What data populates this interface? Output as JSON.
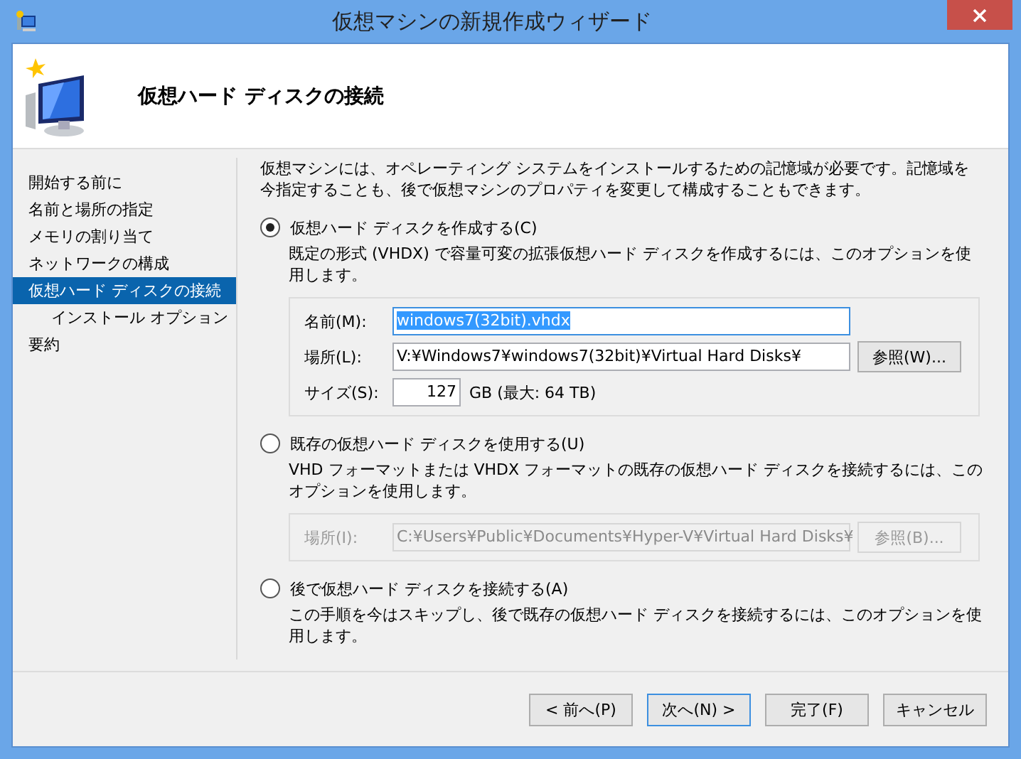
{
  "window": {
    "title": "仮想マシンの新規作成ウィザード"
  },
  "header": {
    "title": "仮想ハード ディスクの接続"
  },
  "sidebar": {
    "items": [
      {
        "label": "開始する前に",
        "selected": false
      },
      {
        "label": "名前と場所の指定",
        "selected": false
      },
      {
        "label": "メモリの割り当て",
        "selected": false
      },
      {
        "label": "ネットワークの構成",
        "selected": false
      },
      {
        "label": "仮想ハード ディスクの接続",
        "selected": true,
        "children": [
          {
            "label": "インストール オプション",
            "selected": false
          }
        ]
      },
      {
        "label": "要約",
        "selected": false
      }
    ]
  },
  "intro": "仮想マシンには、オペレーティング システムをインストールするための記憶域が必要です。記憶域を今指定することも、後で仮想マシンのプロパティを変更して構成することもできます。",
  "options": [
    {
      "label": "仮想ハード ディスクを作成する(C)",
      "selected": true,
      "description": "既定の形式 (VHDX) で容量可変の拡張仮想ハード ディスクを作成するには、このオプションを使用します。",
      "disabled": false,
      "fields": [
        {
          "kind": "text",
          "label": "名前(M):",
          "value": "windows7(32bit).vhdx",
          "highlighted": true
        },
        {
          "kind": "browse",
          "label": "場所(L):",
          "value": "V:¥Windows7¥windows7(32bit)¥Virtual Hard Disks¥",
          "button": "参照(W)..."
        },
        {
          "kind": "size",
          "label": "サイズ(S):",
          "value": "127",
          "unit": "GB (最大: 64 TB)"
        }
      ]
    },
    {
      "label": "既存の仮想ハード ディスクを使用する(U)",
      "selected": false,
      "description": "VHD フォーマットまたは VHDX フォーマットの既存の仮想ハード ディスクを接続するには、このオプションを使用します。",
      "disabled": true,
      "fields": [
        {
          "kind": "browse",
          "label": "場所(I):",
          "value": "C:¥Users¥Public¥Documents¥Hyper-V¥Virtual Hard Disks¥",
          "button": "参照(B)..."
        }
      ]
    },
    {
      "label": "後で仮想ハード ディスクを接続する(A)",
      "selected": false,
      "description": "この手順を今はスキップし、後で既存の仮想ハード ディスクを接続するには、このオプションを使用します。"
    }
  ],
  "buttons": [
    {
      "label": "< 前へ(P)",
      "focused": false
    },
    {
      "label": "次へ(N) >",
      "focused": true
    },
    {
      "label": "完了(F)",
      "focused": false
    },
    {
      "label": "キャンセル",
      "focused": false
    }
  ]
}
